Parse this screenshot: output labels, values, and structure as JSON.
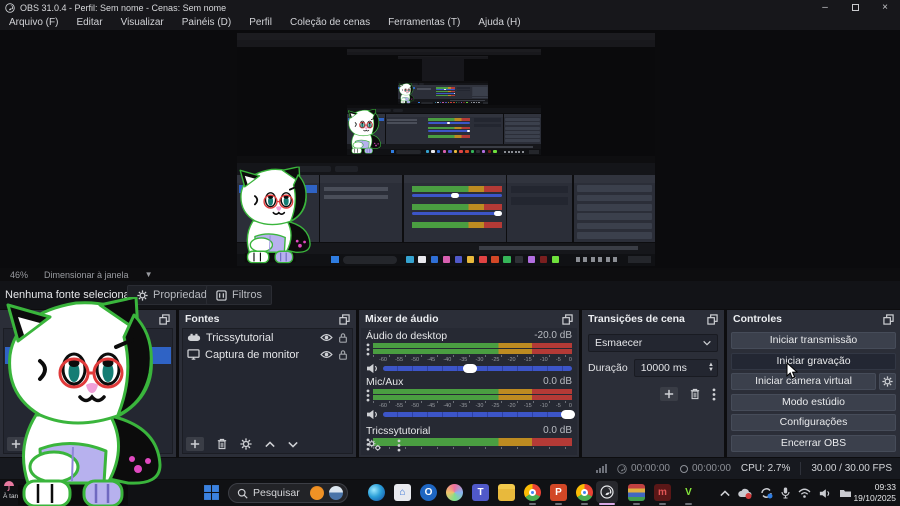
{
  "window": {
    "title": "OBS 31.0.4 - Perfil: Sem nome - Cenas: Sem nome"
  },
  "menu": {
    "items": [
      "Arquivo (F)",
      "Editar",
      "Visualizar",
      "Painéis (D)",
      "Perfil",
      "Coleção de cenas",
      "Ferramentas (T)",
      "Ajuda (H)"
    ]
  },
  "preview": {
    "zoom_level": "46%",
    "scale_mode": "Dimensionar à janela"
  },
  "source_toolbar": {
    "no_source": "Nenhuma fonte selecionada",
    "properties": "Propriedades",
    "filters": "Filtros"
  },
  "docks": {
    "sources": {
      "title": "Fontes",
      "items": [
        {
          "label": "Tricssytutorial"
        },
        {
          "label": "Captura de monitor"
        }
      ]
    },
    "mixer": {
      "title": "Mixer de áudio",
      "ticks": [
        "-60",
        "-55",
        "-50",
        "-45",
        "-40",
        "-35",
        "-30",
        "-25",
        "-20",
        "-15",
        "-10",
        "-5",
        "0"
      ],
      "channels": [
        {
          "name": "Áudio do desktop",
          "level": "-20.0 dB",
          "slider_pct": 46
        },
        {
          "name": "Mic/Aux",
          "level": "0.0 dB",
          "slider_pct": 98
        },
        {
          "name": "Tricssytutorial",
          "level": "0.0 dB"
        }
      ],
      "accent_colors": {
        "meter_green": "#4a9e41",
        "meter_yellow": "#bd8b21",
        "meter_red": "#b43a36",
        "slider_blue": "#3c55c8"
      }
    },
    "transitions": {
      "title": "Transições de cena",
      "selected": "Esmaecer",
      "duration_label": "Duração",
      "duration_value": "10000 ms"
    },
    "controls": {
      "title": "Controles",
      "buttons": [
        "Iniciar transmissão",
        "Iniciar gravação",
        "Iniciar câmera virtual",
        "Modo estúdio",
        "Configurações",
        "Encerrar OBS"
      ]
    }
  },
  "status_bar": {
    "stream_time": "00:00:00",
    "rec_time": "00:00:00",
    "cpu": "CPU: 2.7%",
    "fps": "30.00 / 30.00 FPS"
  },
  "taskbar": {
    "search": "Pesquisar",
    "weather": "À tarde",
    "time": "09:33",
    "date": "19/10/2025"
  }
}
